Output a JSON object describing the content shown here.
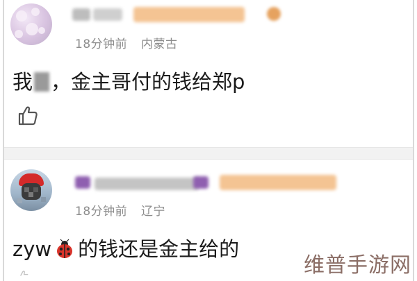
{
  "comments": [
    {
      "user_name_redacted": true,
      "time": "18分钟前",
      "location": "内蒙古",
      "text_before_mask": "我",
      "text_after_mask": "，金主哥付的钱给郑p"
    },
    {
      "user_name_redacted": true,
      "time": "18分钟前",
      "location": "辽宁",
      "text_before_emoji": "zyw",
      "text_after_emoji": "的钱还是金主给的",
      "emoji": "ladybug"
    }
  ],
  "icons": {
    "like": "thumbs-up-icon",
    "emoji": "ladybug-icon"
  },
  "watermark": "维普手游网",
  "colors": {
    "meta_text": "#8c8c8c",
    "content_text": "#1b1b1b",
    "badge_orange": "#f2b27a",
    "watermark": "#8b6e66"
  }
}
